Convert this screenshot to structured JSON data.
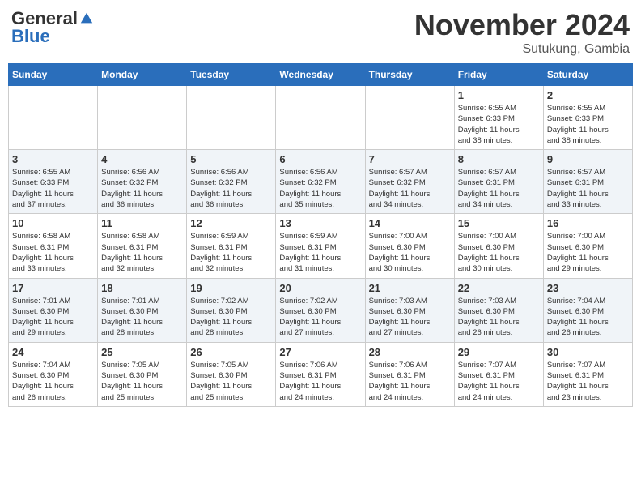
{
  "header": {
    "logo_general": "General",
    "logo_blue": "Blue",
    "month_title": "November 2024",
    "location": "Sutukung, Gambia"
  },
  "days_of_week": [
    "Sunday",
    "Monday",
    "Tuesday",
    "Wednesday",
    "Thursday",
    "Friday",
    "Saturday"
  ],
  "weeks": [
    [
      {
        "day": "",
        "info": ""
      },
      {
        "day": "",
        "info": ""
      },
      {
        "day": "",
        "info": ""
      },
      {
        "day": "",
        "info": ""
      },
      {
        "day": "",
        "info": ""
      },
      {
        "day": "1",
        "info": "Sunrise: 6:55 AM\nSunset: 6:33 PM\nDaylight: 11 hours\nand 38 minutes."
      },
      {
        "day": "2",
        "info": "Sunrise: 6:55 AM\nSunset: 6:33 PM\nDaylight: 11 hours\nand 38 minutes."
      }
    ],
    [
      {
        "day": "3",
        "info": "Sunrise: 6:55 AM\nSunset: 6:33 PM\nDaylight: 11 hours\nand 37 minutes."
      },
      {
        "day": "4",
        "info": "Sunrise: 6:56 AM\nSunset: 6:32 PM\nDaylight: 11 hours\nand 36 minutes."
      },
      {
        "day": "5",
        "info": "Sunrise: 6:56 AM\nSunset: 6:32 PM\nDaylight: 11 hours\nand 36 minutes."
      },
      {
        "day": "6",
        "info": "Sunrise: 6:56 AM\nSunset: 6:32 PM\nDaylight: 11 hours\nand 35 minutes."
      },
      {
        "day": "7",
        "info": "Sunrise: 6:57 AM\nSunset: 6:32 PM\nDaylight: 11 hours\nand 34 minutes."
      },
      {
        "day": "8",
        "info": "Sunrise: 6:57 AM\nSunset: 6:31 PM\nDaylight: 11 hours\nand 34 minutes."
      },
      {
        "day": "9",
        "info": "Sunrise: 6:57 AM\nSunset: 6:31 PM\nDaylight: 11 hours\nand 33 minutes."
      }
    ],
    [
      {
        "day": "10",
        "info": "Sunrise: 6:58 AM\nSunset: 6:31 PM\nDaylight: 11 hours\nand 33 minutes."
      },
      {
        "day": "11",
        "info": "Sunrise: 6:58 AM\nSunset: 6:31 PM\nDaylight: 11 hours\nand 32 minutes."
      },
      {
        "day": "12",
        "info": "Sunrise: 6:59 AM\nSunset: 6:31 PM\nDaylight: 11 hours\nand 32 minutes."
      },
      {
        "day": "13",
        "info": "Sunrise: 6:59 AM\nSunset: 6:31 PM\nDaylight: 11 hours\nand 31 minutes."
      },
      {
        "day": "14",
        "info": "Sunrise: 7:00 AM\nSunset: 6:30 PM\nDaylight: 11 hours\nand 30 minutes."
      },
      {
        "day": "15",
        "info": "Sunrise: 7:00 AM\nSunset: 6:30 PM\nDaylight: 11 hours\nand 30 minutes."
      },
      {
        "day": "16",
        "info": "Sunrise: 7:00 AM\nSunset: 6:30 PM\nDaylight: 11 hours\nand 29 minutes."
      }
    ],
    [
      {
        "day": "17",
        "info": "Sunrise: 7:01 AM\nSunset: 6:30 PM\nDaylight: 11 hours\nand 29 minutes."
      },
      {
        "day": "18",
        "info": "Sunrise: 7:01 AM\nSunset: 6:30 PM\nDaylight: 11 hours\nand 28 minutes."
      },
      {
        "day": "19",
        "info": "Sunrise: 7:02 AM\nSunset: 6:30 PM\nDaylight: 11 hours\nand 28 minutes."
      },
      {
        "day": "20",
        "info": "Sunrise: 7:02 AM\nSunset: 6:30 PM\nDaylight: 11 hours\nand 27 minutes."
      },
      {
        "day": "21",
        "info": "Sunrise: 7:03 AM\nSunset: 6:30 PM\nDaylight: 11 hours\nand 27 minutes."
      },
      {
        "day": "22",
        "info": "Sunrise: 7:03 AM\nSunset: 6:30 PM\nDaylight: 11 hours\nand 26 minutes."
      },
      {
        "day": "23",
        "info": "Sunrise: 7:04 AM\nSunset: 6:30 PM\nDaylight: 11 hours\nand 26 minutes."
      }
    ],
    [
      {
        "day": "24",
        "info": "Sunrise: 7:04 AM\nSunset: 6:30 PM\nDaylight: 11 hours\nand 26 minutes."
      },
      {
        "day": "25",
        "info": "Sunrise: 7:05 AM\nSunset: 6:30 PM\nDaylight: 11 hours\nand 25 minutes."
      },
      {
        "day": "26",
        "info": "Sunrise: 7:05 AM\nSunset: 6:30 PM\nDaylight: 11 hours\nand 25 minutes."
      },
      {
        "day": "27",
        "info": "Sunrise: 7:06 AM\nSunset: 6:31 PM\nDaylight: 11 hours\nand 24 minutes."
      },
      {
        "day": "28",
        "info": "Sunrise: 7:06 AM\nSunset: 6:31 PM\nDaylight: 11 hours\nand 24 minutes."
      },
      {
        "day": "29",
        "info": "Sunrise: 7:07 AM\nSunset: 6:31 PM\nDaylight: 11 hours\nand 24 minutes."
      },
      {
        "day": "30",
        "info": "Sunrise: 7:07 AM\nSunset: 6:31 PM\nDaylight: 11 hours\nand 23 minutes."
      }
    ]
  ]
}
